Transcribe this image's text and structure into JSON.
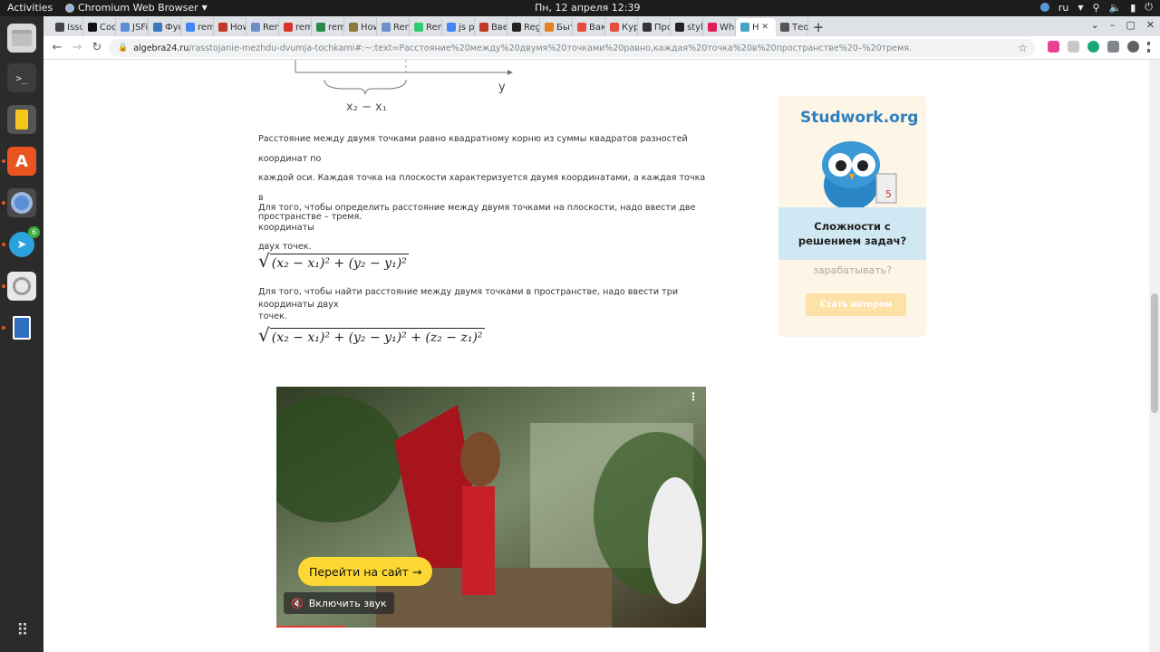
{
  "system_bar": {
    "activities": "Activities",
    "app_name": "Chromium Web Browser",
    "clock": "Пн, 12 апреля  12:39",
    "language": "ru"
  },
  "dock": {
    "telegram_badge": "6",
    "items": [
      "files-icon",
      "terminal-icon",
      "calculator-icon",
      "app-store-icon",
      "chromium-icon",
      "telegram-icon",
      "settings-icon",
      "document-icon"
    ]
  },
  "tabs": [
    {
      "label": "Issu",
      "color": "#444444"
    },
    {
      "label": "Cod",
      "color": "#111111"
    },
    {
      "label": "JSFi",
      "color": "#5b8ed6"
    },
    {
      "label": "Фун",
      "color": "#3a78c2"
    },
    {
      "label": "rem",
      "color": "#4285f4"
    },
    {
      "label": "How",
      "color": "#c0392b"
    },
    {
      "label": "Rem",
      "color": "#6b8fc9"
    },
    {
      "label": "rem",
      "color": "#d9342b"
    },
    {
      "label": "rem",
      "color": "#2b8a4a"
    },
    {
      "label": "How",
      "color": "#8e7a3a"
    },
    {
      "label": "Rem",
      "color": "#6b8fc9"
    },
    {
      "label": "Rem",
      "color": "#2ecc71"
    },
    {
      "label": "js pe",
      "color": "#4285f4"
    },
    {
      "label": "Вве",
      "color": "#c0392b"
    },
    {
      "label": "Regi",
      "color": "#222222"
    },
    {
      "label": "Быт",
      "color": "#e67e22"
    },
    {
      "label": "Вак",
      "color": "#e74c3c"
    },
    {
      "label": "Кур",
      "color": "#e74c3c"
    },
    {
      "label": "Про",
      "color": "#333333"
    },
    {
      "label": "stylu",
      "color": "#222222"
    },
    {
      "label": "Whe",
      "color": "#e01e5a"
    },
    {
      "label": "Н",
      "color": "#46a3c7",
      "active": true
    },
    {
      "label": "Теор",
      "color": "#555555"
    }
  ],
  "address_bar": {
    "domain": "algebra24.ru",
    "path": "/rasstojanie-mezhdu-dvumja-tochkami#:~:text=Расстояние%20между%20двумя%20точками%20равно,каждая%20точка%20в%20пространстве%20–%20тремя."
  },
  "diagram": {
    "axis_label": "y",
    "brace_label": "x₂ − x₁"
  },
  "article": {
    "p1_line1": "Расстояние между двумя точками равно квадратному корню из суммы квадратов разностей координат по",
    "p1_line2": "каждой оси. Каждая точка на плоскости характеризуется двумя координатами, а каждая точка в",
    "p1_line3": "пространстве – тремя.",
    "p2_line1": "Для того, чтобы определить расстояние между двумя точками на плоскости, надо ввести две координаты",
    "p2_line2": "двух точек.",
    "formula_2d": "(x₂ − x₁)² + (y₂ − y₁)²",
    "p3_line1": "Для того, чтобы найти расстояние между двумя точками в пространстве, надо ввести три координаты двух",
    "p3_line2": "точек.",
    "formula_3d": "(x₂ − x₁)² + (y₂ − y₁)² + (z₂ − z₁)²"
  },
  "ad": {
    "logo": "Studwork.org",
    "bubble_line1": "Сложности с",
    "bubble_line2": "решением задач?",
    "earn_text": "зарабатывать?",
    "cta": "Стать автором",
    "badge_number": "5"
  },
  "video": {
    "go_button": "Перейти на сайт",
    "sound_button": "Включить звук",
    "progress": 0.16
  }
}
